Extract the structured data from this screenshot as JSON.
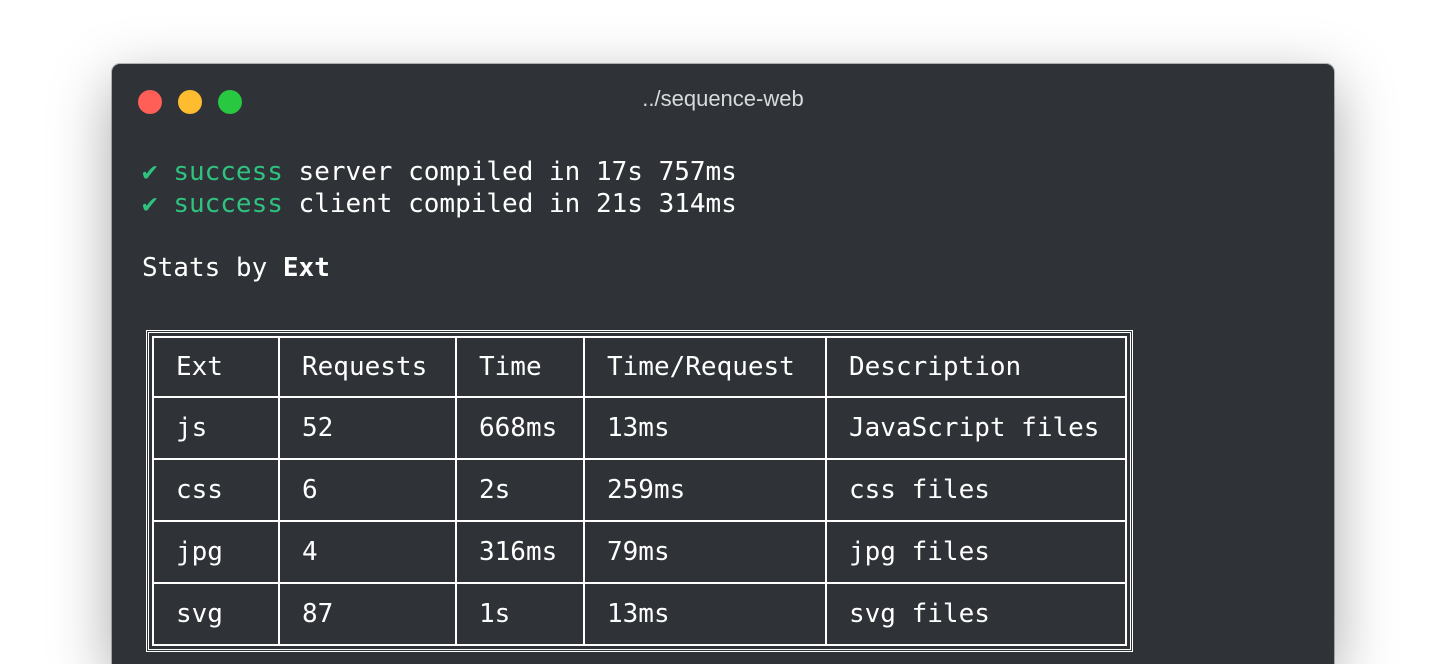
{
  "window": {
    "title": "../sequence-web"
  },
  "log": [
    {
      "icon": "✔",
      "status": "success",
      "message": " server compiled in 17s 757ms"
    },
    {
      "icon": "✔",
      "status": "success",
      "message": " client compiled in 21s 314ms"
    }
  ],
  "stats": {
    "heading_prefix": "Stats by ",
    "heading_key": "Ext"
  },
  "table": {
    "headers": [
      "Ext",
      "Requests",
      "Time",
      "Time/Request",
      "Description"
    ],
    "rows": [
      [
        "js",
        "52",
        "668ms",
        "13ms",
        "JavaScript files"
      ],
      [
        "css",
        "6",
        "2s",
        "259ms",
        "css files"
      ],
      [
        "jpg",
        "4",
        "316ms",
        "79ms",
        "jpg files"
      ],
      [
        "svg",
        "87",
        "1s",
        "13ms",
        "svg files"
      ]
    ]
  },
  "colors": {
    "terminal_bg": "#2f3337",
    "success": "#2ec27e",
    "close": "#ff5f57",
    "minimize": "#febc2e",
    "zoom": "#28c840"
  }
}
